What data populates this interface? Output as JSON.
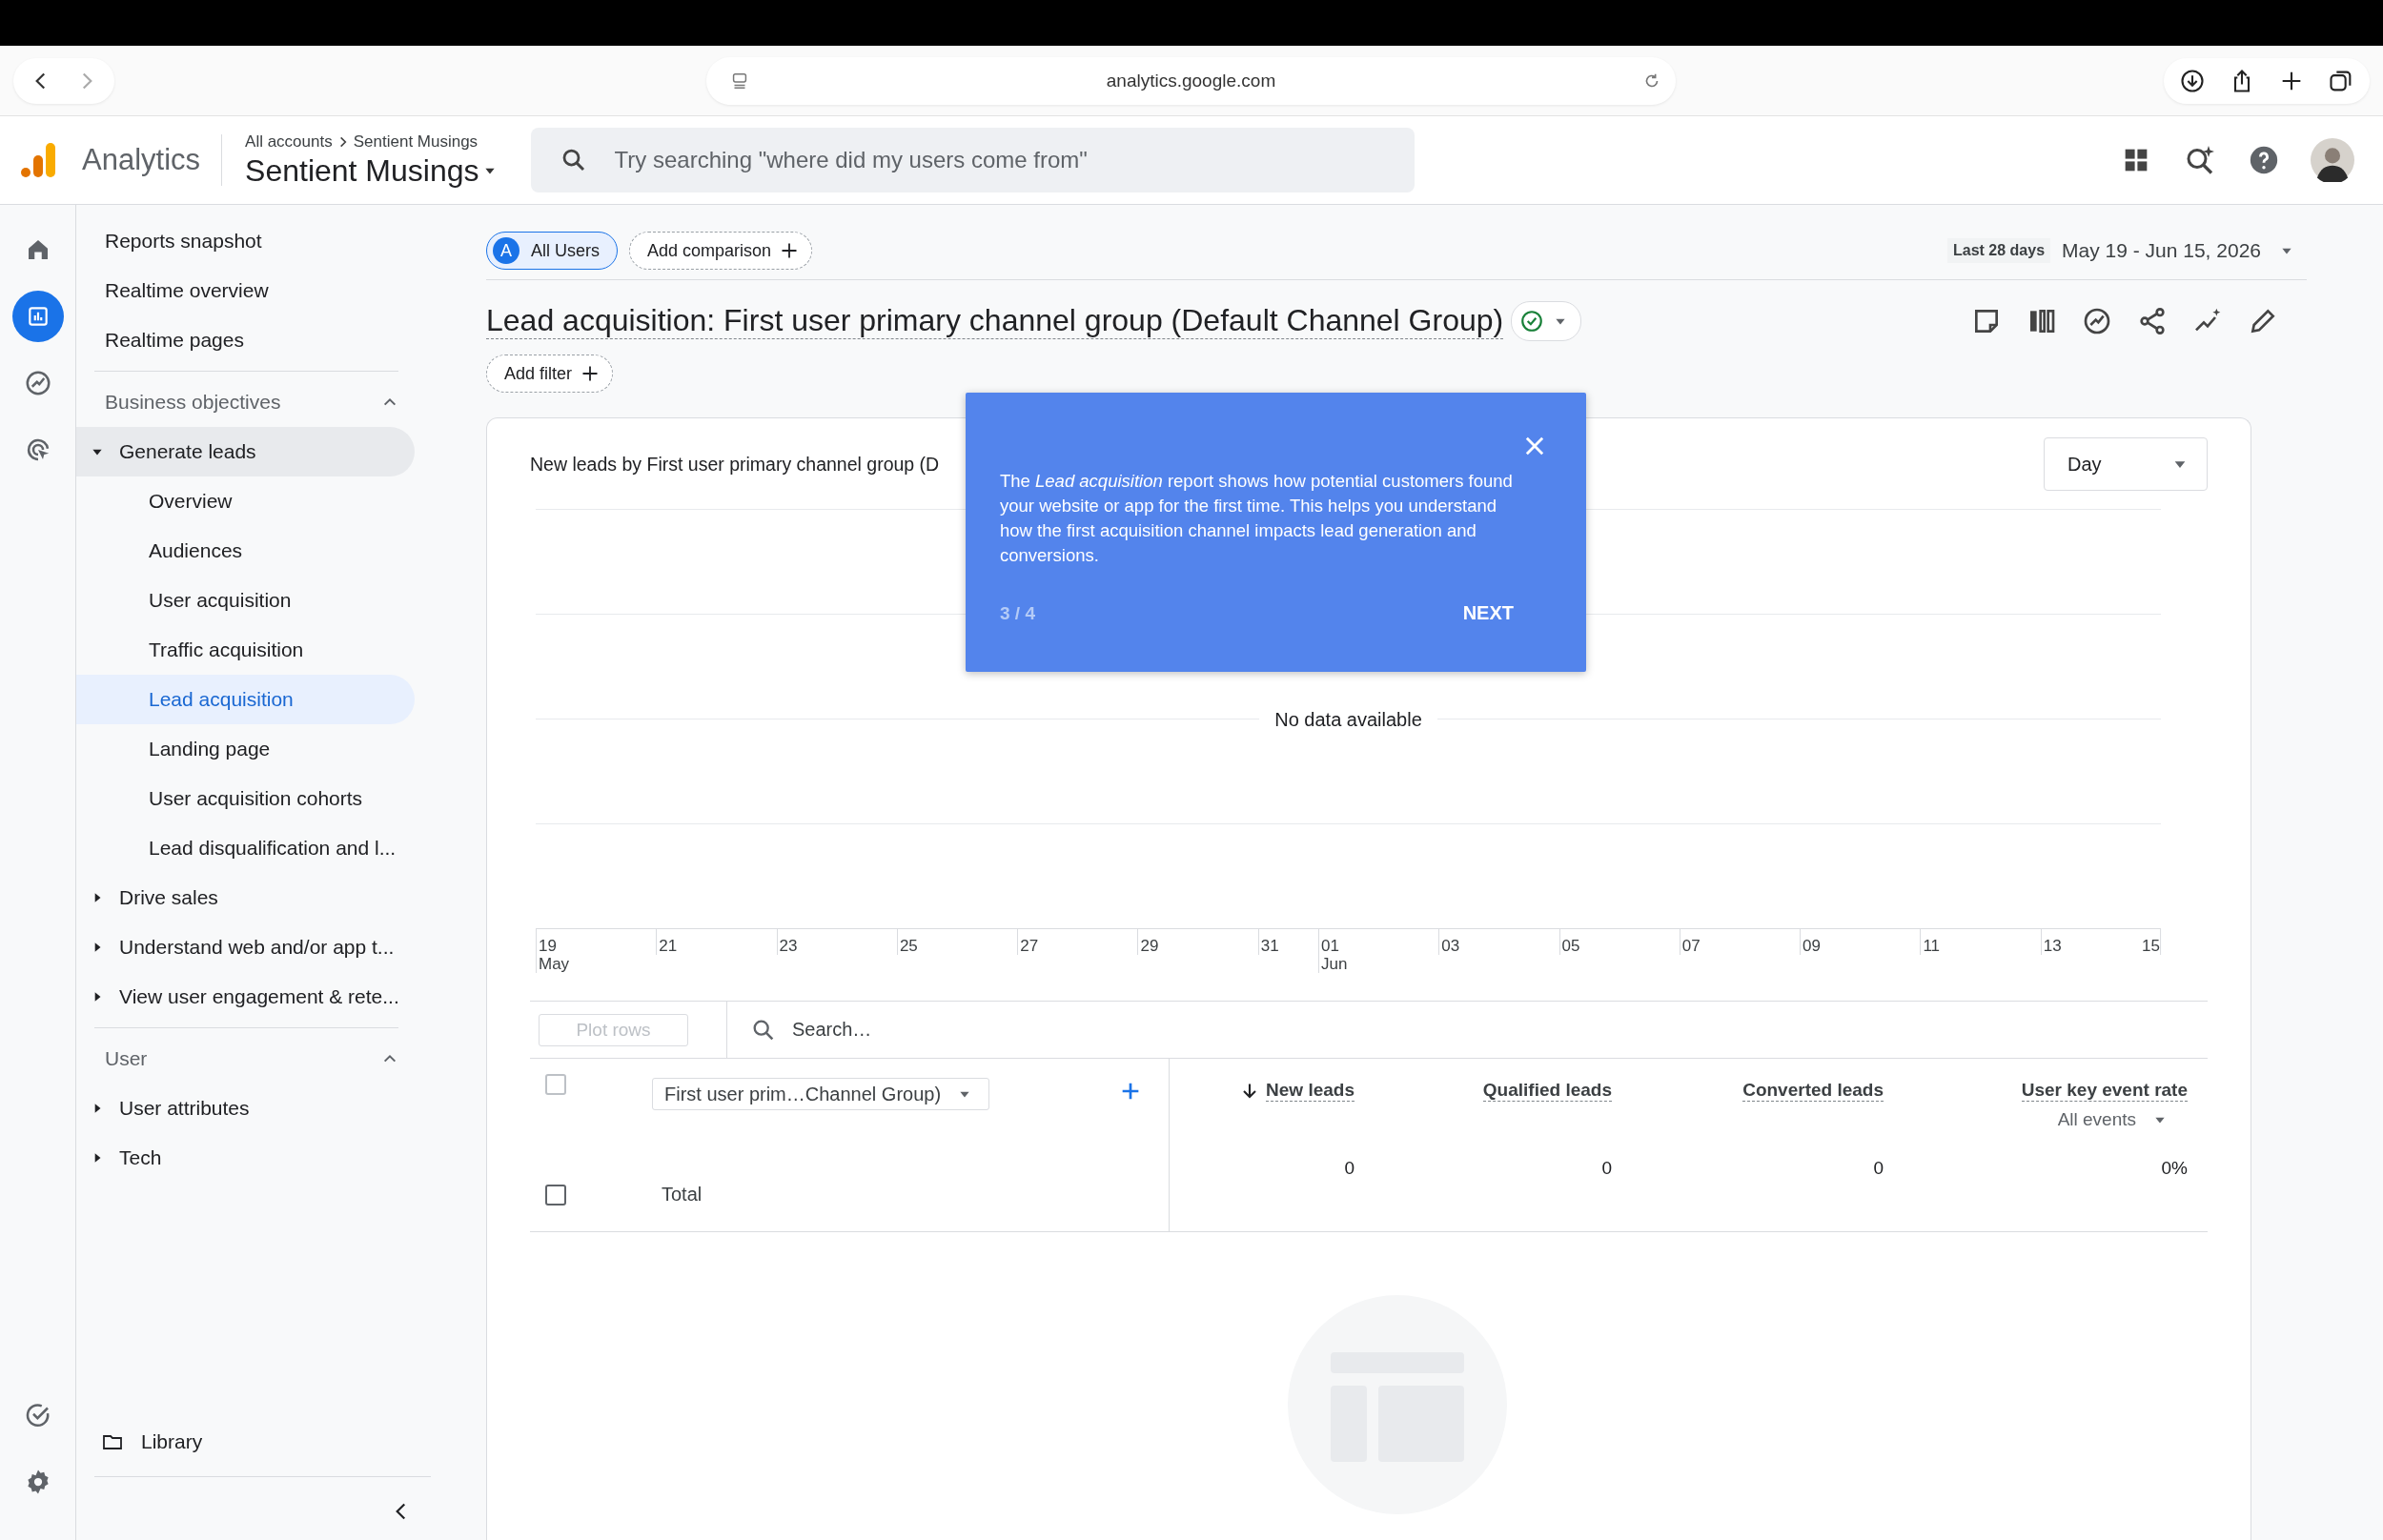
{
  "browser": {
    "url": "analytics.google.com"
  },
  "app": {
    "product": "Analytics",
    "breadcrumb": [
      "All accounts",
      "Sentient Musings"
    ],
    "property": "Sentient Musings",
    "search": {
      "placeholder": "Try searching \"where did my users come from\""
    }
  },
  "rail": {
    "items": [
      {
        "kind": "home",
        "selected": false
      },
      {
        "kind": "reports",
        "selected": true
      },
      {
        "kind": "explore",
        "selected": false
      },
      {
        "kind": "advertising",
        "selected": false
      }
    ],
    "bottom": [
      {
        "kind": "check",
        "selected": false
      },
      {
        "kind": "settings",
        "selected": false
      }
    ]
  },
  "sidebar": {
    "top_items": [
      {
        "label": "Reports snapshot",
        "selected": false
      },
      {
        "label": "Realtime overview",
        "selected": false
      },
      {
        "label": "Realtime pages",
        "selected": false
      }
    ],
    "sections": [
      {
        "title": "Business objectives",
        "expanded": true,
        "items": [
          {
            "label": "Generate leads",
            "expanded": true,
            "children": [
              {
                "label": "Overview",
                "selected": false
              },
              {
                "label": "Audiences",
                "selected": false
              },
              {
                "label": "User acquisition",
                "selected": false
              },
              {
                "label": "Traffic acquisition",
                "selected": false
              },
              {
                "label": "Lead acquisition",
                "selected": true
              },
              {
                "label": "Landing page",
                "selected": false
              },
              {
                "label": "User acquisition cohorts",
                "selected": false
              },
              {
                "label": "Lead disqualification and l...",
                "selected": false
              }
            ]
          },
          {
            "label": "Drive sales",
            "expanded": false
          },
          {
            "label": "Understand web and/or app t...",
            "expanded": false
          },
          {
            "label": "View user engagement & rete...",
            "expanded": false
          }
        ]
      },
      {
        "title": "User",
        "expanded": true,
        "items": [
          {
            "label": "User attributes",
            "expanded": false
          },
          {
            "label": "Tech",
            "expanded": false
          }
        ]
      }
    ],
    "library": "Library"
  },
  "comparison": {
    "chips": [
      {
        "letter": "A",
        "label": "All Users"
      }
    ],
    "add": "Add comparison"
  },
  "date": {
    "preset": "Last 28 days",
    "range": "May 19 - Jun 15, 2026"
  },
  "report": {
    "title": "Lead acquisition: First user primary channel group (Default Channel Group)",
    "add_filter": "Add filter"
  },
  "chart": {
    "title": "New leads by First user primary channel group (D",
    "interval": "Day",
    "empty_message": "No data available",
    "axis_labels": [
      {
        "day": "19",
        "month": "May"
      },
      {
        "day": "21"
      },
      {
        "day": "23"
      },
      {
        "day": "25"
      },
      {
        "day": "27"
      },
      {
        "day": "29"
      },
      {
        "day": "31"
      },
      {
        "day": "01",
        "month": "Jun"
      },
      {
        "day": "03"
      },
      {
        "day": "05"
      },
      {
        "day": "07"
      },
      {
        "day": "09"
      },
      {
        "day": "11"
      },
      {
        "day": "13"
      },
      {
        "day": "15"
      }
    ]
  },
  "popover": {
    "text": "The *Lead acquisition* report shows how potential customers found your website or app for the first time. This helps you understand how the first acquisition channel impacts lead generation and conversions.",
    "step": "3 / 4",
    "next": "NEXT"
  },
  "table": {
    "plot_rows": {
      "label": "Plot rows",
      "disabled": true
    },
    "select_all": {
      "checked": false,
      "disabled": true
    },
    "search_placeholder": "Search…",
    "dimension": "First user prim…Channel Group)",
    "columns": [
      {
        "label": "New leads",
        "sorted": true
      },
      {
        "label": "Qualified leads",
        "sorted": false
      },
      {
        "label": "Converted leads",
        "sorted": false
      },
      {
        "label": "User key event rate",
        "sorted": false,
        "sub": "All events"
      }
    ],
    "total": {
      "label": "Total",
      "checked": false,
      "values": [
        "0",
        "0",
        "0",
        "0%"
      ]
    }
  }
}
